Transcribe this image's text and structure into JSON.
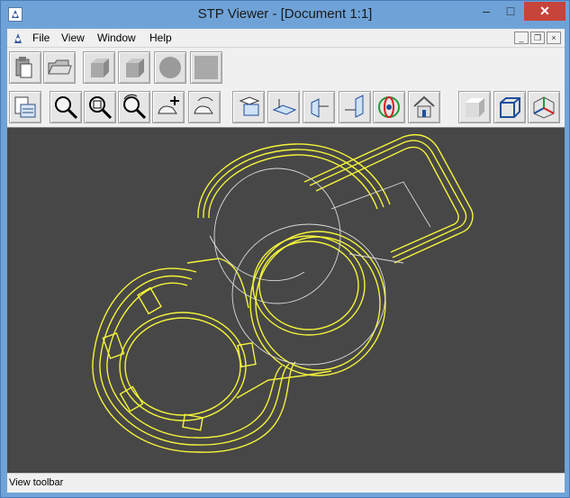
{
  "window": {
    "title": "STP Viewer - [Document 1:1]",
    "minimize_glyph": "–",
    "maximize_glyph": "□",
    "close_glyph": "✕"
  },
  "menu": {
    "items": [
      "File",
      "View",
      "Window",
      "Help"
    ],
    "mdi_min": "_",
    "mdi_restore": "❐",
    "mdi_close": "×"
  },
  "toolbar1": [
    "clipboard-icon",
    "open-folder-icon",
    "solid-box-icon",
    "solid-box-icon",
    "sphere-icon",
    "blank-icon"
  ],
  "toolbar2": [
    "document-properties-icon",
    "zoom-icon",
    "zoom-window-icon",
    "zoom-rotate-icon",
    "pan-icon",
    "rotate-hand-icon",
    "view-front-icon",
    "view-top-icon",
    "view-left-icon",
    "view-right-icon",
    "axo-view-icon",
    "home-view-icon",
    "shaded-icon",
    "wireframe-icon",
    "axes-icon"
  ],
  "status": {
    "text": "View toolbar"
  },
  "colors": {
    "viewport_bg": "#474747",
    "wireframe": "#f4f43a",
    "edges": "#dcdcdc"
  }
}
